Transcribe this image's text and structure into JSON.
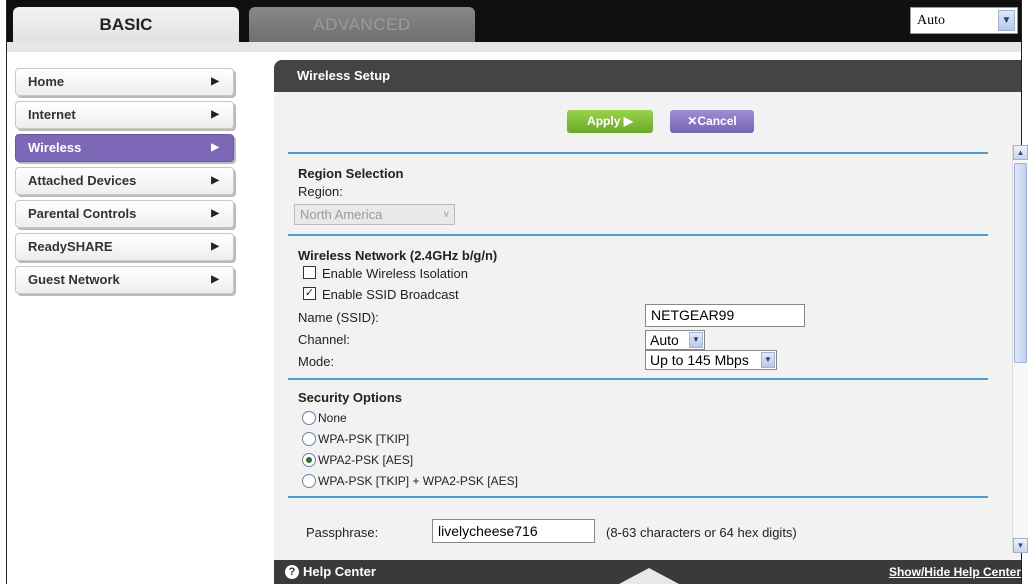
{
  "tabs": {
    "basic": "BASIC",
    "advanced": "ADVANCED"
  },
  "language": {
    "value": "Auto"
  },
  "nav": {
    "items": [
      {
        "label": "Home"
      },
      {
        "label": "Internet"
      },
      {
        "label": "Wireless",
        "active": true
      },
      {
        "label": "Attached Devices"
      },
      {
        "label": "Parental Controls"
      },
      {
        "label": "ReadySHARE"
      },
      {
        "label": "Guest Network"
      }
    ]
  },
  "panel": {
    "title": "Wireless Setup",
    "apply_label": "Apply ▶",
    "cancel_label": "✕Cancel"
  },
  "region": {
    "heading": "Region Selection",
    "label": "Region:",
    "value": "North America"
  },
  "wireless": {
    "heading": "Wireless Network (2.4GHz b/g/n)",
    "isolation_label": "Enable Wireless Isolation",
    "isolation_checked": false,
    "ssid_broadcast_label": "Enable SSID Broadcast",
    "ssid_broadcast_checked": true,
    "name_label": "Name (SSID):",
    "name_value": "NETGEAR99",
    "channel_label": "Channel:",
    "channel_value": "Auto",
    "mode_label": "Mode:",
    "mode_value": "Up to 145 Mbps"
  },
  "security": {
    "heading": "Security Options",
    "options": [
      {
        "label": "None",
        "selected": false
      },
      {
        "label": "WPA-PSK [TKIP]",
        "selected": false
      },
      {
        "label": "WPA2-PSK [AES]",
        "selected": true
      },
      {
        "label": "WPA-PSK [TKIP] + WPA2-PSK [AES]",
        "selected": false
      }
    ],
    "passphrase_label": "Passphrase:",
    "passphrase_value": "livelycheese716",
    "passphrase_hint": "(8-63 characters or 64 hex digits)"
  },
  "help": {
    "label": "Help Center",
    "toggle_label": "Show/Hide Help Center"
  },
  "colors": {
    "accent_purple": "#7c68b6",
    "apply_green": "#7fbf3a",
    "divider_blue": "#4e9bd0",
    "panel_header": "#444444"
  }
}
